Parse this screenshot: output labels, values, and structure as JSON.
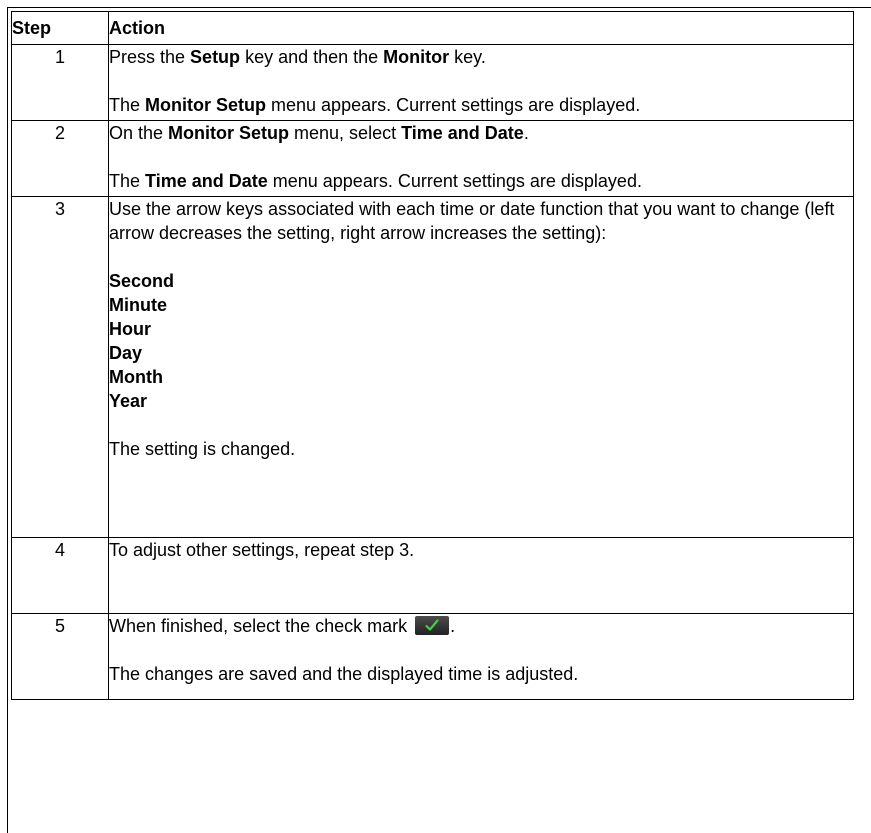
{
  "headers": {
    "step": "Step",
    "action": "Action"
  },
  "rows": [
    {
      "step": "1",
      "line1": {
        "pre": "Press the ",
        "b1": "Setup",
        "mid": " key and then the ",
        "b2": "Monitor",
        "post": " key."
      },
      "line2": {
        "pre": "The ",
        "b1": "Monitor Setup",
        "post": " menu appears. Current settings are displayed."
      }
    },
    {
      "step": "2",
      "line1": {
        "pre": "On the ",
        "b1": "Monitor Setup",
        "mid": " menu, select ",
        "b2": "Time and Date",
        "post": "."
      },
      "line2": {
        "pre": "The ",
        "b1": "Time and Date",
        "post": " menu appears. Current settings are displayed."
      }
    },
    {
      "step": "3",
      "intro": "Use the arrow keys associated with each time or date function that you want to change (left arrow decreases the setting, right arrow increases the setting):",
      "functions": [
        "Second",
        "Minute",
        "Hour",
        "Day",
        "Month",
        "Year"
      ],
      "result": "The setting is changed."
    },
    {
      "step": "4",
      "text": "To adjust other settings, repeat step 3."
    },
    {
      "step": "5",
      "line1_pre": "When finished, select the check mark ",
      "line1_post": ".",
      "line2": "The changes are saved and the displayed time is adjusted.",
      "icon": "check-mark-icon",
      "icon_color": "#3fd23f"
    }
  ]
}
